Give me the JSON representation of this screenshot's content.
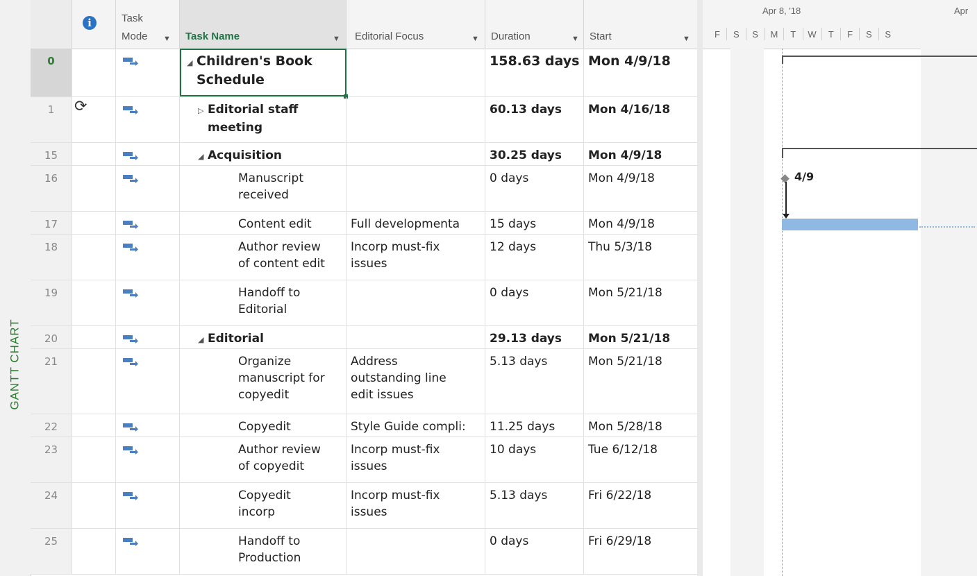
{
  "view_bar": {
    "label": "GANTT CHART"
  },
  "columns": {
    "info_icon": "info-icon",
    "task_mode": [
      "Task",
      "Mode"
    ],
    "task_name": "Task Name",
    "editorial_focus": "Editorial Focus",
    "duration": "Duration",
    "start": "Start"
  },
  "rows": [
    {
      "id": "0",
      "indent": 0,
      "toggle": "collapse",
      "name": [
        "Children's Book",
        "Schedule"
      ],
      "focus": [],
      "duration": "158.63 days",
      "start": "Mon 4/9/18",
      "bold": true,
      "recurring": false
    },
    {
      "id": "1",
      "indent": 1,
      "toggle": "expand",
      "name": [
        "Editorial staff",
        "meeting"
      ],
      "focus": [],
      "duration": "60.13 days",
      "start": "Mon 4/16/18",
      "bold": true,
      "recurring": true
    },
    {
      "id": "15",
      "indent": 1,
      "toggle": "collapse",
      "name": [
        "Acquisition"
      ],
      "focus": [],
      "duration": "30.25 days",
      "start": "Mon 4/9/18",
      "bold": true,
      "recurring": false
    },
    {
      "id": "16",
      "indent": 2,
      "toggle": "",
      "name": [
        "Manuscript",
        "received"
      ],
      "focus": [],
      "duration": "0 days",
      "start": "Mon 4/9/18",
      "bold": false,
      "recurring": false
    },
    {
      "id": "17",
      "indent": 2,
      "toggle": "",
      "name": [
        "Content edit"
      ],
      "focus": [
        "Full developmenta"
      ],
      "duration": "15 days",
      "start": "Mon 4/9/18",
      "bold": false,
      "recurring": false
    },
    {
      "id": "18",
      "indent": 2,
      "toggle": "",
      "name": [
        "Author review",
        "of content edit"
      ],
      "focus": [
        "Incorp must-fix",
        "issues"
      ],
      "duration": "12 days",
      "start": "Thu 5/3/18",
      "bold": false,
      "recurring": false
    },
    {
      "id": "19",
      "indent": 2,
      "toggle": "",
      "name": [
        "Handoff to",
        "Editorial"
      ],
      "focus": [],
      "duration": "0 days",
      "start": "Mon 5/21/18",
      "bold": false,
      "recurring": false
    },
    {
      "id": "20",
      "indent": 1,
      "toggle": "collapse",
      "name": [
        "Editorial"
      ],
      "focus": [],
      "duration": "29.13 days",
      "start": "Mon 5/21/18",
      "bold": true,
      "recurring": false
    },
    {
      "id": "21",
      "indent": 2,
      "toggle": "",
      "name": [
        "Organize",
        "manuscript for",
        "copyedit"
      ],
      "focus": [
        "Address",
        "outstanding line",
        "edit issues"
      ],
      "duration": "5.13 days",
      "start": "Mon 5/21/18",
      "bold": false,
      "recurring": false
    },
    {
      "id": "22",
      "indent": 2,
      "toggle": "",
      "name": [
        "Copyedit"
      ],
      "focus": [
        "Style Guide compli:"
      ],
      "duration": "11.25 days",
      "start": "Mon 5/28/18",
      "bold": false,
      "recurring": false
    },
    {
      "id": "23",
      "indent": 2,
      "toggle": "",
      "name": [
        "Author review",
        "of copyedit"
      ],
      "focus": [
        "Incorp must-fix",
        "issues"
      ],
      "duration": "10 days",
      "start": "Tue 6/12/18",
      "bold": false,
      "recurring": false
    },
    {
      "id": "24",
      "indent": 2,
      "toggle": "",
      "name": [
        "Copyedit",
        "incorp"
      ],
      "focus": [
        "Incorp must-fix",
        "issues"
      ],
      "duration": "5.13 days",
      "start": "Fri 6/22/18",
      "bold": false,
      "recurring": false
    },
    {
      "id": "25",
      "indent": 2,
      "toggle": "",
      "name": [
        "Handoff to",
        "Production"
      ],
      "focus": [],
      "duration": "0 days",
      "start": "Fri 6/29/18",
      "bold": false,
      "recurring": false
    }
  ],
  "gantt": {
    "week_label": "Apr 8, '18",
    "next_week_label": "Apr",
    "days": [
      "F",
      "S",
      "S",
      "M",
      "T",
      "W",
      "T",
      "F",
      "S",
      "S"
    ],
    "milestone_label": "4/9"
  }
}
